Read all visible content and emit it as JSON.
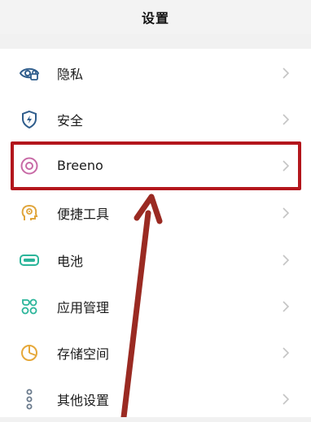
{
  "header": {
    "title": "设置"
  },
  "items": [
    {
      "label": "隐私",
      "icon": "eye-lock-icon",
      "color": "#2f5d8c"
    },
    {
      "label": "安全",
      "icon": "shield-icon",
      "color": "#2f5d8c"
    },
    {
      "label": "Breeno",
      "icon": "breeno-ring-icon",
      "color": "#c86aa6"
    },
    {
      "label": "便捷工具",
      "icon": "head-tool-icon",
      "color": "#e0a53b"
    },
    {
      "label": "电池",
      "icon": "battery-icon",
      "color": "#2bb59a"
    },
    {
      "label": "应用管理",
      "icon": "apps-grid-icon",
      "color": "#2bb59a"
    },
    {
      "label": "存储空间",
      "icon": "storage-pie-icon",
      "color": "#e6a83a"
    },
    {
      "label": "其他设置",
      "icon": "more-dots-icon",
      "color": "#6a7a8c"
    }
  ],
  "annotation": {
    "highlight_color": "#b3161c",
    "arrow_color": "#9a2a22"
  }
}
